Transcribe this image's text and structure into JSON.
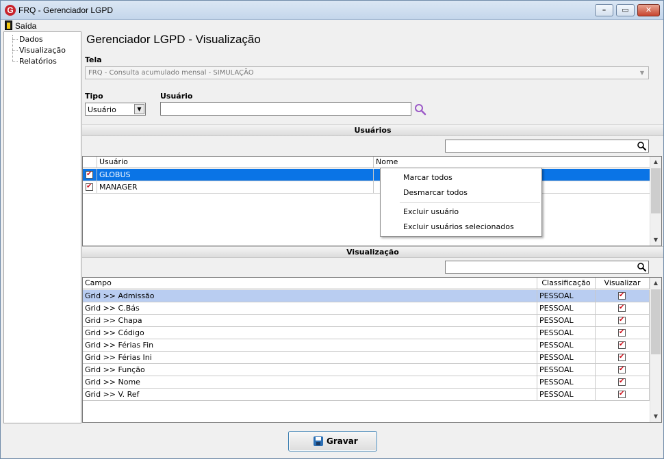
{
  "window": {
    "title": "FRQ - Gerenciador LGPD",
    "app_icon_letter": "G",
    "controls": {
      "minimize": "–",
      "maximize": "▭",
      "close": "✕"
    }
  },
  "menubar": {
    "exit_label": "Saída"
  },
  "sidebar": {
    "items": [
      {
        "label": "Dados"
      },
      {
        "label": "Visualização"
      },
      {
        "label": "Relatórios"
      }
    ]
  },
  "page_title": "Gerenciador LGPD - Visualização",
  "tela": {
    "label": "Tela",
    "value": "FRQ - Consulta acumulado mensal - SIMULAÇÃO"
  },
  "tipo": {
    "label": "Tipo",
    "value": "Usuário"
  },
  "usuario_field": {
    "label": "Usuário",
    "value": ""
  },
  "usuarios_section": {
    "title": "Usuários",
    "columns": [
      "Usuário",
      "Nome"
    ],
    "rows": [
      {
        "usuario": "GLOBUS",
        "nome": "",
        "checked": true,
        "selected": true
      },
      {
        "usuario": "MANAGER",
        "nome": "",
        "checked": true,
        "selected": false
      }
    ]
  },
  "context_menu": {
    "items": [
      "Marcar todos",
      "Desmarcar todos",
      "Excluir usuário",
      "Excluir usuários selecionados"
    ]
  },
  "visualizacao_section": {
    "title": "Visualização",
    "columns": [
      "Campo",
      "Classificação",
      "Visualizar"
    ],
    "rows": [
      {
        "campo": "Grid >> Admissão",
        "classificacao": "PESSOAL",
        "visualizar": true
      },
      {
        "campo": "Grid >> C.Bás",
        "classificacao": "PESSOAL",
        "visualizar": true
      },
      {
        "campo": "Grid >> Chapa",
        "classificacao": "PESSOAL",
        "visualizar": true
      },
      {
        "campo": "Grid >> Código",
        "classificacao": "PESSOAL",
        "visualizar": true
      },
      {
        "campo": "Grid >> Férias Fin",
        "classificacao": "PESSOAL",
        "visualizar": true
      },
      {
        "campo": "Grid >> Férias Ini",
        "classificacao": "PESSOAL",
        "visualizar": true
      },
      {
        "campo": "Grid >> Função",
        "classificacao": "PESSOAL",
        "visualizar": true
      },
      {
        "campo": "Grid >> Nome",
        "classificacao": "PESSOAL",
        "visualizar": true
      },
      {
        "campo": "Grid >> V. Ref",
        "classificacao": "PESSOAL",
        "visualizar": true
      }
    ]
  },
  "footer": {
    "save_label": "Gravar"
  },
  "colors": {
    "selection_blue": "#0a74e6",
    "row_highlight": "#b9cdf1",
    "check_red": "#d0121d",
    "search_purple": "#9b59c7"
  }
}
